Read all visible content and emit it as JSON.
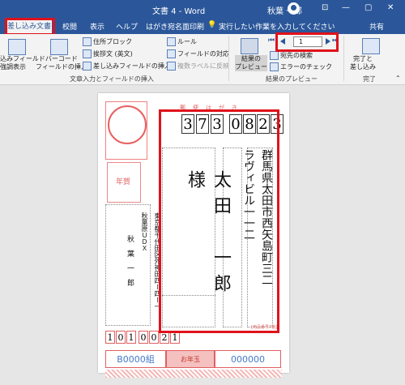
{
  "titlebar": {
    "title": "文書 4  -  Word",
    "user": "秋葉 一郎",
    "minimize": "—",
    "restore": "▢",
    "close": "✕"
  },
  "tabs": {
    "active": "差し込み文書",
    "items": [
      "校閲",
      "表示",
      "ヘルプ",
      "はがき宛名面印刷"
    ],
    "tell_me": "実行したい作業を入力してください",
    "share": "共有"
  },
  "ribbon": {
    "field_display": "込みフィールド\n強調表示",
    "barcode": "バーコード\nフィールドの挿入",
    "address_block": "住所ブロック",
    "greeting": "挨拶文 (英文)",
    "insert_merge_field": "差し込みフィールドの挿入",
    "rules": "ルール",
    "match_fields": "フィールドの対応",
    "update_labels": "複数ラベルに反映",
    "group_fields": "文章入力とフィールドの挿入",
    "preview_results": "結果の\nプレビュー",
    "record_number": "1",
    "find_recipient": "宛先の検索",
    "check_errors": "エラーのチェック",
    "group_preview": "結果のプレビュー",
    "finish_merge": "完了と\n差し込み",
    "group_finish": "完了"
  },
  "card": {
    "header": "郵　便　は　が　き",
    "zip": [
      "3",
      "7",
      "3",
      "0",
      "8",
      "2",
      "3"
    ],
    "recipient_address": "群馬県太田市西矢島町三二\nラヴィビル一一二",
    "recipient_name": "太田　一郎　様",
    "sender_address": "東京都千代田区外神田四ー四ー一\n秋葉原ＵＤＸ",
    "sender_name": "秋　葉　一　郎",
    "sender_zip": [
      "1",
      "0",
      "1",
      "0",
      "0",
      "2",
      "1"
    ],
    "lottery_left": "B0000組",
    "lottery_right": "000000",
    "lottery_center": "お年玉",
    "nenga": "年賀",
    "fine_print": "[用品番号7番]"
  }
}
